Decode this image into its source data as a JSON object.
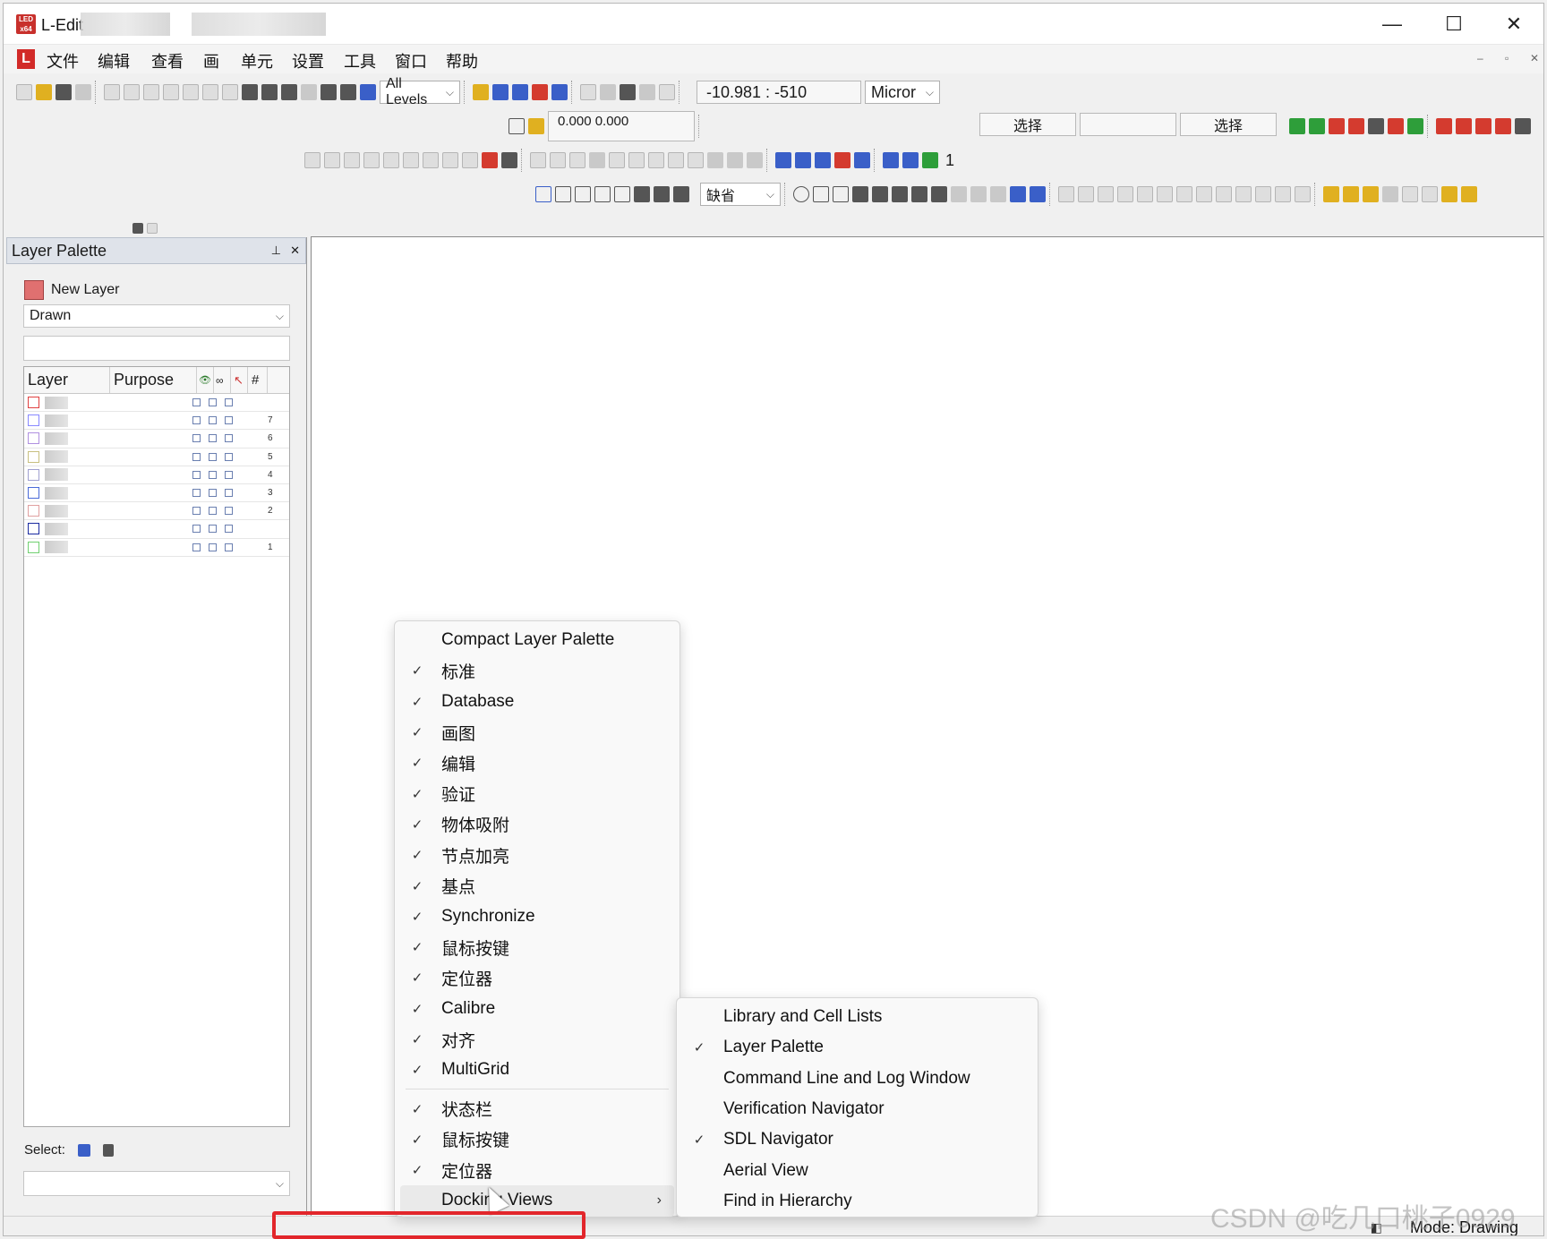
{
  "window": {
    "title": "L-Edit",
    "logo_text": "LED x64",
    "controls": {
      "minimize": "—",
      "maximize": "☐",
      "close": "✕"
    }
  },
  "menubar": {
    "logo": "L",
    "items": [
      "文件",
      "编辑",
      "查看",
      "画",
      "单元",
      "设置",
      "工具",
      "窗口",
      "帮助"
    ],
    "mdi_controls": [
      "–",
      "▫",
      "✕"
    ]
  },
  "toolbar": {
    "levels_combo": "All Levels",
    "cursor_coords": "-10.981 : -510",
    "units_combo": "Micror",
    "offset_value": "0.000 0.000",
    "select_button_1": "选择",
    "select_button_2": "选择",
    "default_style_combo": "缺省",
    "grid_count": "1"
  },
  "layer_palette": {
    "title": "Layer Palette",
    "pin": "⊥",
    "close": "✕",
    "new_layer_label": "New Layer",
    "filter_combo": "Drawn",
    "columns": [
      "Layer",
      "Purpose",
      "👁",
      "∞",
      "↖",
      "#"
    ],
    "rows": [
      {
        "color": "#e04040",
        "num": ""
      },
      {
        "color": "#8888ff",
        "num": "7"
      },
      {
        "color": "#b090e0",
        "num": "6"
      },
      {
        "color": "#c8c080",
        "num": "5"
      },
      {
        "color": "#a0a0d0",
        "num": "4"
      },
      {
        "color": "#4a6ad8",
        "num": "3"
      },
      {
        "color": "#e0a0a0",
        "num": "2"
      },
      {
        "color": "#1a2aa0",
        "num": ""
      },
      {
        "color": "#70d070",
        "num": "1"
      }
    ],
    "select_label": "Select:"
  },
  "context_menu": {
    "items": [
      {
        "label": "Compact Layer Palette",
        "checked": false
      },
      {
        "label": "标准",
        "checked": true
      },
      {
        "label": "Database",
        "checked": true
      },
      {
        "label": "画图",
        "checked": true
      },
      {
        "label": "编辑",
        "checked": true
      },
      {
        "label": "验证",
        "checked": true
      },
      {
        "label": "物体吸附",
        "checked": true
      },
      {
        "label": "节点加亮",
        "checked": true
      },
      {
        "label": "基点",
        "checked": true
      },
      {
        "label": "Synchronize",
        "checked": true
      },
      {
        "label": "鼠标按键",
        "checked": true
      },
      {
        "label": "定位器",
        "checked": true
      },
      {
        "label": "Calibre",
        "checked": true
      },
      {
        "label": "对齐",
        "checked": true
      },
      {
        "label": "MultiGrid",
        "checked": true
      }
    ],
    "items2": [
      {
        "label": "状态栏",
        "checked": true
      },
      {
        "label": "鼠标按键",
        "checked": true
      },
      {
        "label": "定位器",
        "checked": true
      }
    ],
    "submenu_trigger": "Docking Views",
    "check_glyph": "✓",
    "arrow_glyph": "›"
  },
  "submenu": {
    "items": [
      {
        "label": "Library and Cell Lists",
        "checked": false
      },
      {
        "label": "Layer Palette",
        "checked": true
      },
      {
        "label": "Command Line and Log Window",
        "checked": false
      },
      {
        "label": "Verification Navigator",
        "checked": false
      },
      {
        "label": "SDL Navigator",
        "checked": true
      },
      {
        "label": "Aerial View",
        "checked": false
      },
      {
        "label": "Find in Hierarchy",
        "checked": false
      }
    ]
  },
  "statusbar": {
    "mode": "Mode: Drawing"
  },
  "watermark": "CSDN @吃几口桃子0929",
  "colors": {
    "highlight_box": "#e2262b",
    "panel_header": "#dfe3ea"
  }
}
